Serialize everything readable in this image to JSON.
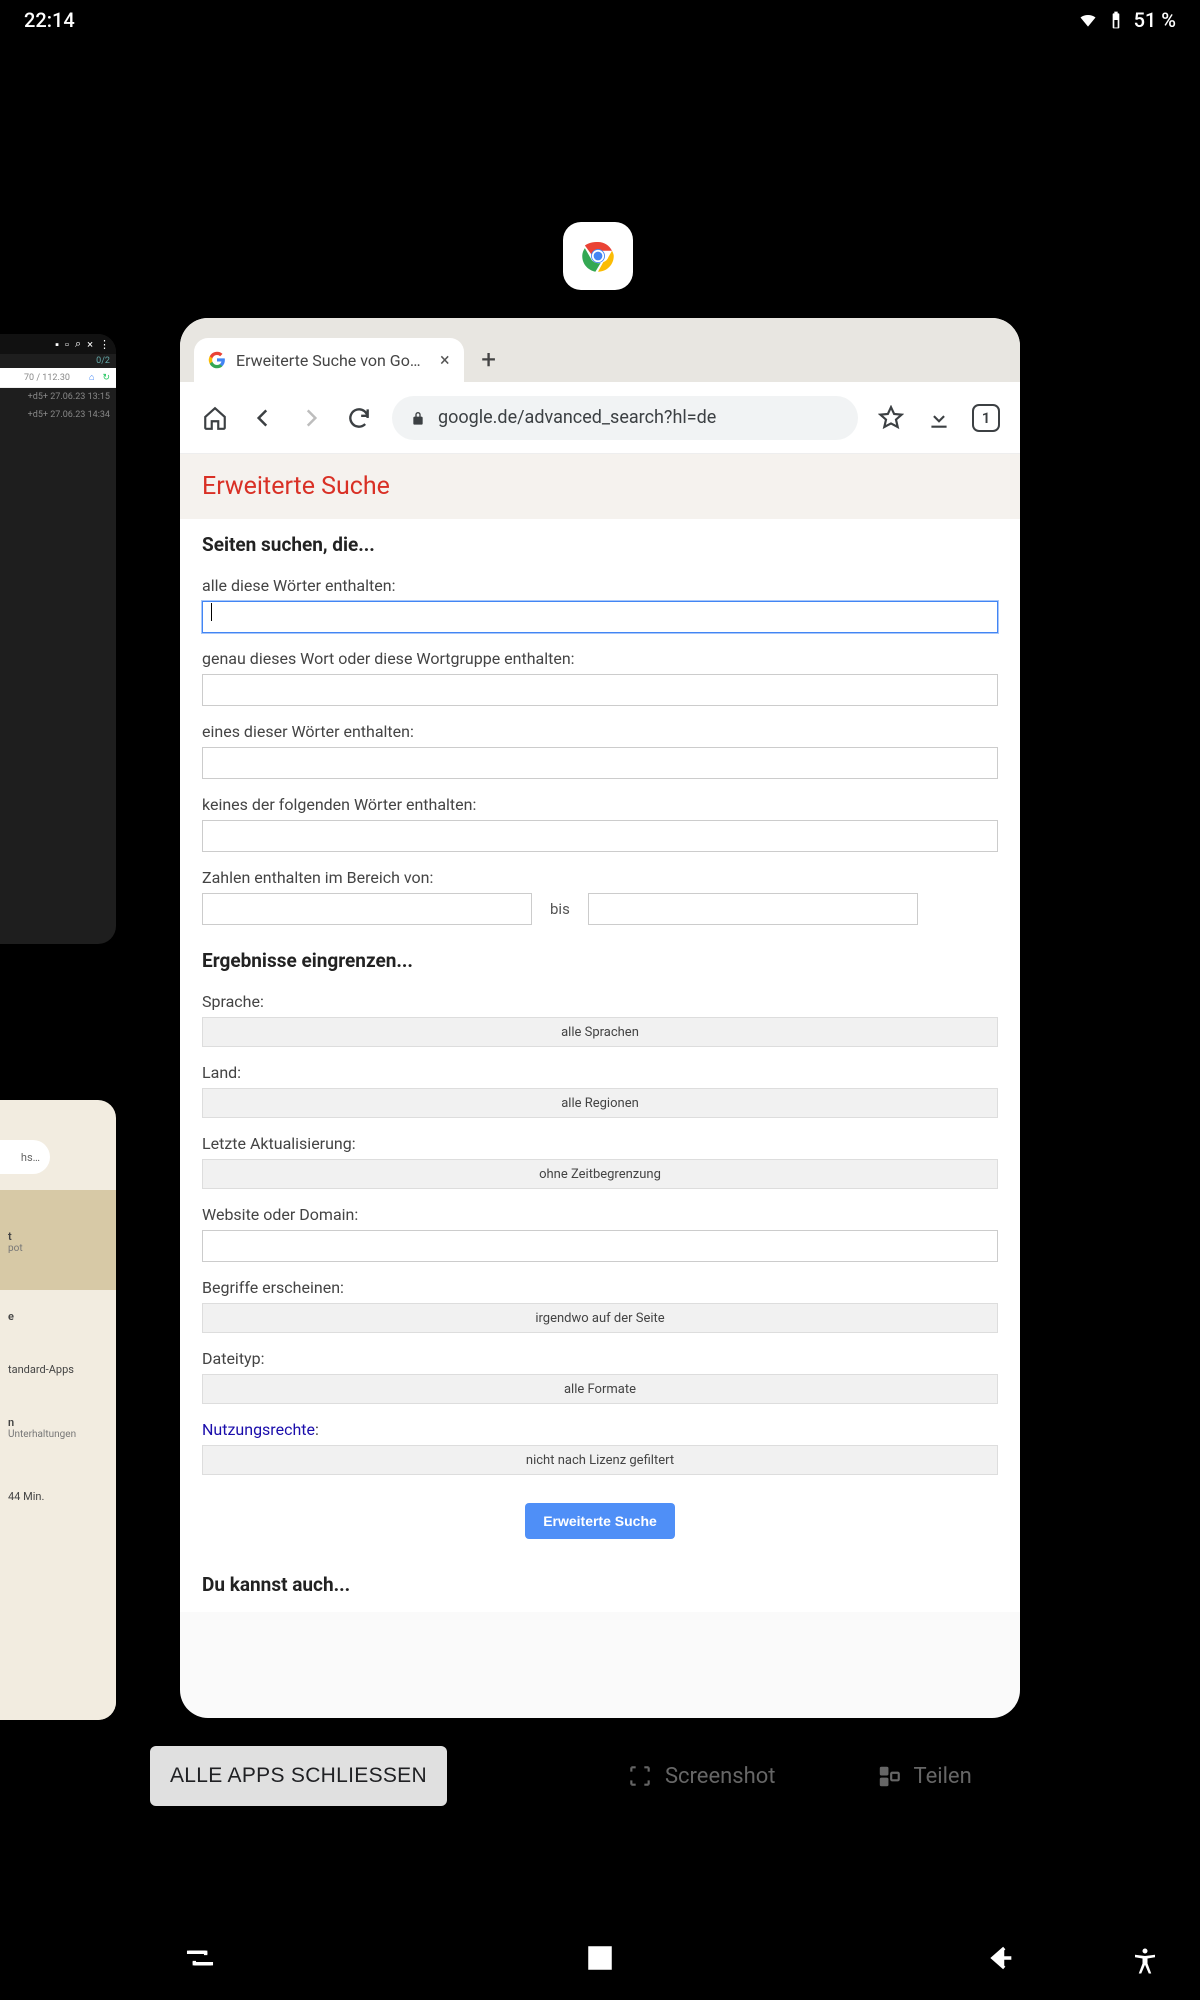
{
  "status": {
    "time": "22:14",
    "battery_pct": "51 %"
  },
  "recents": {
    "close_all": "ALLE APPS SCHLIESSEN",
    "screenshot": "Screenshot",
    "share": "Teilen"
  },
  "side1": {
    "counter": "0/2",
    "line1": "70 / 112.30",
    "row1": "+d5+  27.06.23  13:15",
    "row2": "+d5+  27.06.23  14:34"
  },
  "side2": {
    "pill": "hs…",
    "block_line1": "t",
    "block_line2": "pot",
    "body_line1": "e",
    "body_text1": "tandard-Apps",
    "body_line2": "n",
    "body_text2": "Unterhaltungen",
    "body_time": "44 Min."
  },
  "chrome": {
    "tab_title": "Erweiterte Suche von Google",
    "url": "google.de/advanced_search?hl=de",
    "tab_count": "1"
  },
  "page": {
    "title": "Erweiterte Suche",
    "section1": "Seiten suchen, die...",
    "f_all": "alle diese Wörter enthalten:",
    "f_exact": "genau dieses Wort oder diese Wortgruppe enthalten:",
    "f_any": "eines dieser Wörter enthalten:",
    "f_none": "keines der folgenden Wörter enthalten:",
    "f_range": "Zahlen enthalten im Bereich von:",
    "range_sep": "bis",
    "section2": "Ergebnisse eingrenzen...",
    "lang_label": "Sprache:",
    "lang_val": "alle Sprachen",
    "country_label": "Land:",
    "country_val": "alle Regionen",
    "update_label": "Letzte Aktualisierung:",
    "update_val": "ohne Zeitbegrenzung",
    "site_label": "Website oder Domain:",
    "terms_label": "Begriffe erscheinen:",
    "terms_val": "irgendwo auf der Seite",
    "filetype_label": "Dateityp:",
    "filetype_val": "alle Formate",
    "rights_label": "Nutzungsrechte",
    "rights_colon": ":",
    "rights_val": "nicht nach Lizenz gefiltert",
    "submit": "Erweiterte Suche",
    "also": "Du kannst auch..."
  }
}
